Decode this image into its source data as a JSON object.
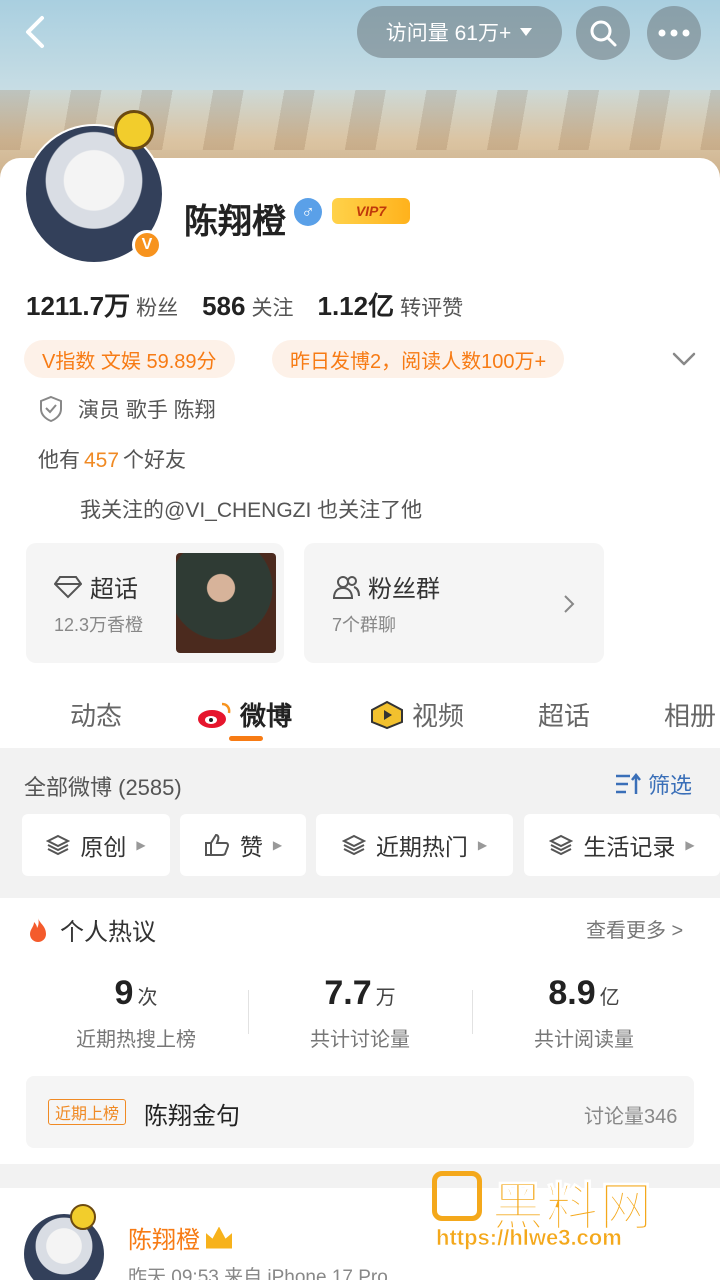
{
  "header": {
    "visits_label": "访问量 61万+",
    "back_icon": "chevron-left-icon",
    "search_icon": "search-icon",
    "more_icon": "more-icon"
  },
  "profile": {
    "name": "陈翔橙",
    "gender_symbol": "♂",
    "vip_label": "VIP7",
    "avatar_v": "V",
    "stats": [
      {
        "value": "1211.7万",
        "label": "粉丝"
      },
      {
        "value": "586",
        "label": "关注"
      },
      {
        "value": "1.12亿",
        "label": "转评赞"
      }
    ],
    "pills": [
      "V指数 文娱 59.89分",
      "昨日发博2，阅读人数100万+"
    ],
    "certification": "演员 歌手 陈翔",
    "friends_prefix": "他有",
    "friends_count": "457",
    "friends_suffix": "个好友",
    "mutual": "我关注的@VI_CHENGZI 也关注了他"
  },
  "tiles": {
    "super_topic": {
      "title": "超话",
      "sub": "12.3万香橙"
    },
    "fan_group": {
      "title": "粉丝群",
      "sub": "7个群聊"
    }
  },
  "tabs": [
    "动态",
    "微博",
    "视频",
    "超话",
    "相册"
  ],
  "filters": {
    "all_posts": "全部微博 (2585)",
    "filter_label": "筛选",
    "chips": [
      "原创",
      "赞",
      "近期热门",
      "生活记录"
    ]
  },
  "hot": {
    "title": "个人热议",
    "more": "查看更多 >",
    "metrics": [
      {
        "value": "9",
        "unit": "次",
        "label": "近期热搜上榜"
      },
      {
        "value": "7.7",
        "unit": "万",
        "label": "共计讨论量"
      },
      {
        "value": "8.9",
        "unit": "亿",
        "label": "共计阅读量"
      }
    ],
    "topic": {
      "badge": "近期上榜",
      "name": "陈翔金句",
      "count": "讨论量346"
    }
  },
  "post": {
    "name": "陈翔橙",
    "meta": "昨天 09:53  来自 iPhone 17 Pro..."
  },
  "watermark": {
    "text": "黑料网",
    "url": "https://hlwe3.com"
  },
  "colors": {
    "accent": "#f77b14",
    "link": "#3a6fb8",
    "watermark": "#f4a81b"
  }
}
